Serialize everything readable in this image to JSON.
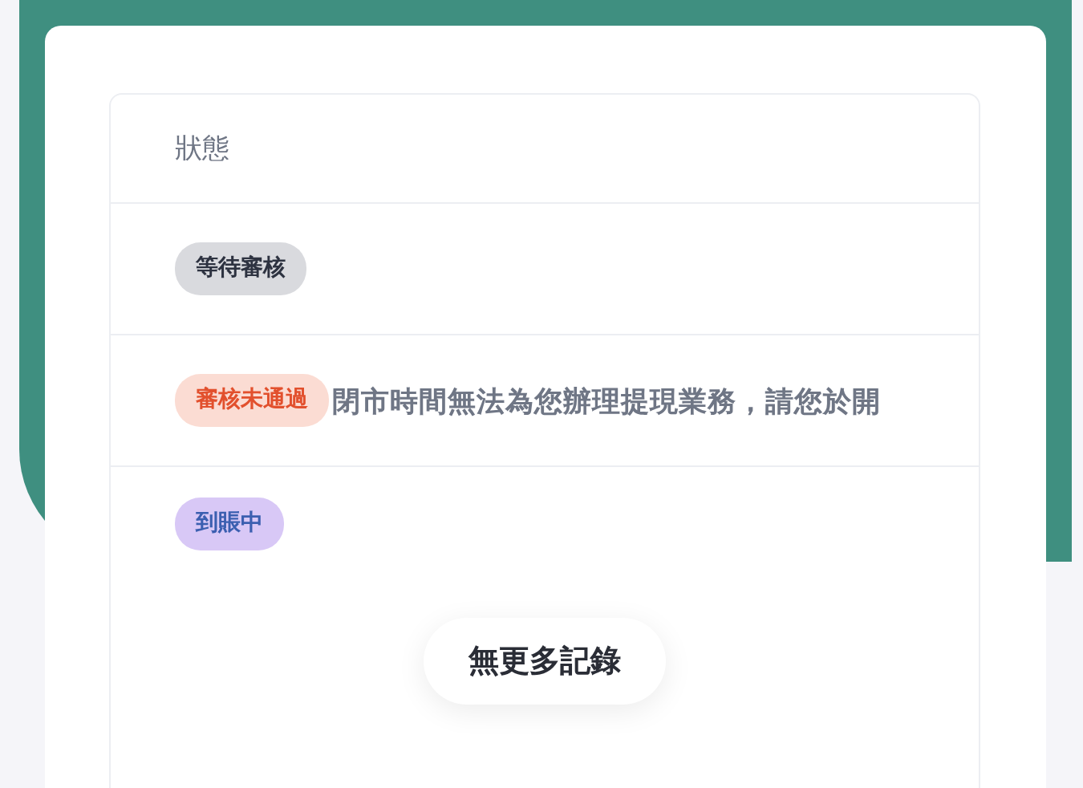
{
  "table": {
    "columns": [
      "狀態"
    ],
    "rows": [
      {
        "status": {
          "kind": "pending",
          "label": "等待審核"
        }
      },
      {
        "status": {
          "kind": "rejected",
          "label": "審核未通過"
        },
        "note": "閉市時間無法為您辦理提現業務，請您於開"
      },
      {
        "status": {
          "kind": "arriving",
          "label": "到賬中"
        }
      }
    ]
  },
  "end_message": "無更多記錄"
}
